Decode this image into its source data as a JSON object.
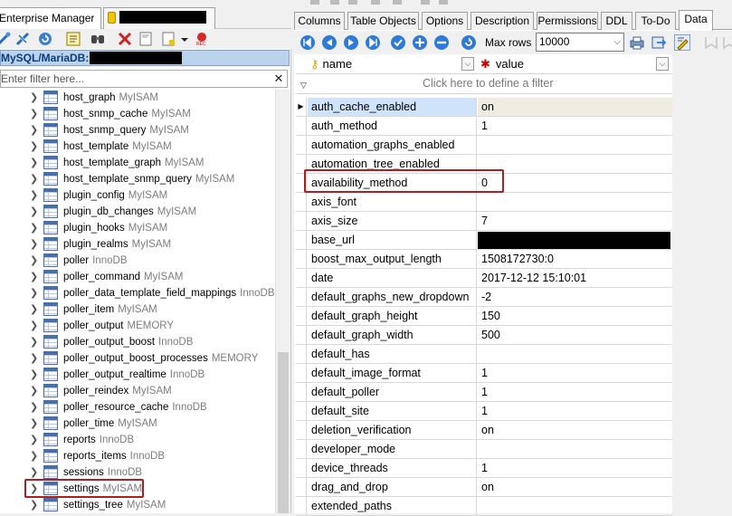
{
  "left_panel": {
    "tabs": [
      {
        "label": "Enterprise Manager"
      },
      {
        "label": ""
      }
    ],
    "toolbar_icons": [
      "connect-icon",
      "disconnect-icon",
      "refresh-icon",
      "sql-editor-icon",
      "find-icon",
      "drop-icon",
      "ddl-icon",
      "ddl-dropdown-icon",
      "rec-icon"
    ],
    "connection_label": "MySQL/MariaDB:",
    "filter_placeholder": "Enter filter here...",
    "filter_clear": "✕",
    "tables": [
      {
        "name": "host_graph",
        "engine": "MyISAM"
      },
      {
        "name": "host_snmp_cache",
        "engine": "MyISAM"
      },
      {
        "name": "host_snmp_query",
        "engine": "MyISAM"
      },
      {
        "name": "host_template",
        "engine": "MyISAM"
      },
      {
        "name": "host_template_graph",
        "engine": "MyISAM"
      },
      {
        "name": "host_template_snmp_query",
        "engine": "MyISAM"
      },
      {
        "name": "plugin_config",
        "engine": "MyISAM"
      },
      {
        "name": "plugin_db_changes",
        "engine": "MyISAM"
      },
      {
        "name": "plugin_hooks",
        "engine": "MyISAM"
      },
      {
        "name": "plugin_realms",
        "engine": "MyISAM"
      },
      {
        "name": "poller",
        "engine": "InnoDB"
      },
      {
        "name": "poller_command",
        "engine": "MyISAM"
      },
      {
        "name": "poller_data_template_field_mappings",
        "engine": "InnoDB"
      },
      {
        "name": "poller_item",
        "engine": "MyISAM"
      },
      {
        "name": "poller_output",
        "engine": "MEMORY"
      },
      {
        "name": "poller_output_boost",
        "engine": "InnoDB"
      },
      {
        "name": "poller_output_boost_processes",
        "engine": "MEMORY"
      },
      {
        "name": "poller_output_realtime",
        "engine": "InnoDB"
      },
      {
        "name": "poller_reindex",
        "engine": "MyISAM"
      },
      {
        "name": "poller_resource_cache",
        "engine": "InnoDB"
      },
      {
        "name": "poller_time",
        "engine": "MyISAM"
      },
      {
        "name": "reports",
        "engine": "InnoDB"
      },
      {
        "name": "reports_items",
        "engine": "InnoDB"
      },
      {
        "name": "sessions",
        "engine": "InnoDB"
      },
      {
        "name": "settings",
        "engine": "MyISAM",
        "highlighted": true
      },
      {
        "name": "settings_tree",
        "engine": "MyISAM"
      }
    ]
  },
  "right_panel": {
    "tabs": [
      {
        "label": "Columns"
      },
      {
        "label": "Table Objects"
      },
      {
        "label": "Options"
      },
      {
        "label": "Description"
      },
      {
        "label": "Permissions"
      },
      {
        "label": "DDL"
      },
      {
        "label": "To-Do"
      },
      {
        "label": "Data",
        "active": true
      }
    ],
    "toolbar": {
      "nav_icons": [
        "first-record-icon",
        "prior-record-icon",
        "next-record-icon",
        "last-record-icon",
        "post-edit-icon",
        "insert-record-icon",
        "delete-record-icon",
        "refresh-data-icon"
      ],
      "max_rows_label": "Max rows",
      "max_rows_value": "10000",
      "extra_icons": [
        "print-icon",
        "export-icon",
        "edit-mode-icon"
      ]
    },
    "grid": {
      "columns": [
        {
          "label": "name",
          "icon": "primary-key-icon"
        },
        {
          "label": "value",
          "icon": "required-star-icon"
        }
      ],
      "filter_text": "Click here to define a filter",
      "rows": [
        {
          "name": "auth_cache_enabled",
          "value": "on",
          "current": true
        },
        {
          "name": "auth_method",
          "value": "1",
          "highlighted": true
        },
        {
          "name": "automation_graphs_enabled",
          "value": ""
        },
        {
          "name": "automation_tree_enabled",
          "value": ""
        },
        {
          "name": "availability_method",
          "value": "0"
        },
        {
          "name": "axis_font",
          "value": ""
        },
        {
          "name": "axis_size",
          "value": "7"
        },
        {
          "name": "base_url",
          "value": "",
          "redacted": true
        },
        {
          "name": "boost_max_output_length",
          "value": "1508172730:0"
        },
        {
          "name": "date",
          "value": "2017-12-12 15:10:01"
        },
        {
          "name": "default_graphs_new_dropdown",
          "value": "-2"
        },
        {
          "name": "default_graph_height",
          "value": "150"
        },
        {
          "name": "default_graph_width",
          "value": "500"
        },
        {
          "name": "default_has",
          "value": ""
        },
        {
          "name": "default_image_format",
          "value": "1"
        },
        {
          "name": "default_poller",
          "value": "1"
        },
        {
          "name": "default_site",
          "value": "1"
        },
        {
          "name": "deletion_verification",
          "value": "on"
        },
        {
          "name": "developer_mode",
          "value": ""
        },
        {
          "name": "device_threads",
          "value": "1"
        },
        {
          "name": "drag_and_drop",
          "value": "on"
        },
        {
          "name": "extended_paths",
          "value": ""
        }
      ]
    }
  },
  "colors": {
    "highlight_border": "#b01e23",
    "connection_bar": "#bcd3ee",
    "current_row_name": "#cfe3fb"
  }
}
